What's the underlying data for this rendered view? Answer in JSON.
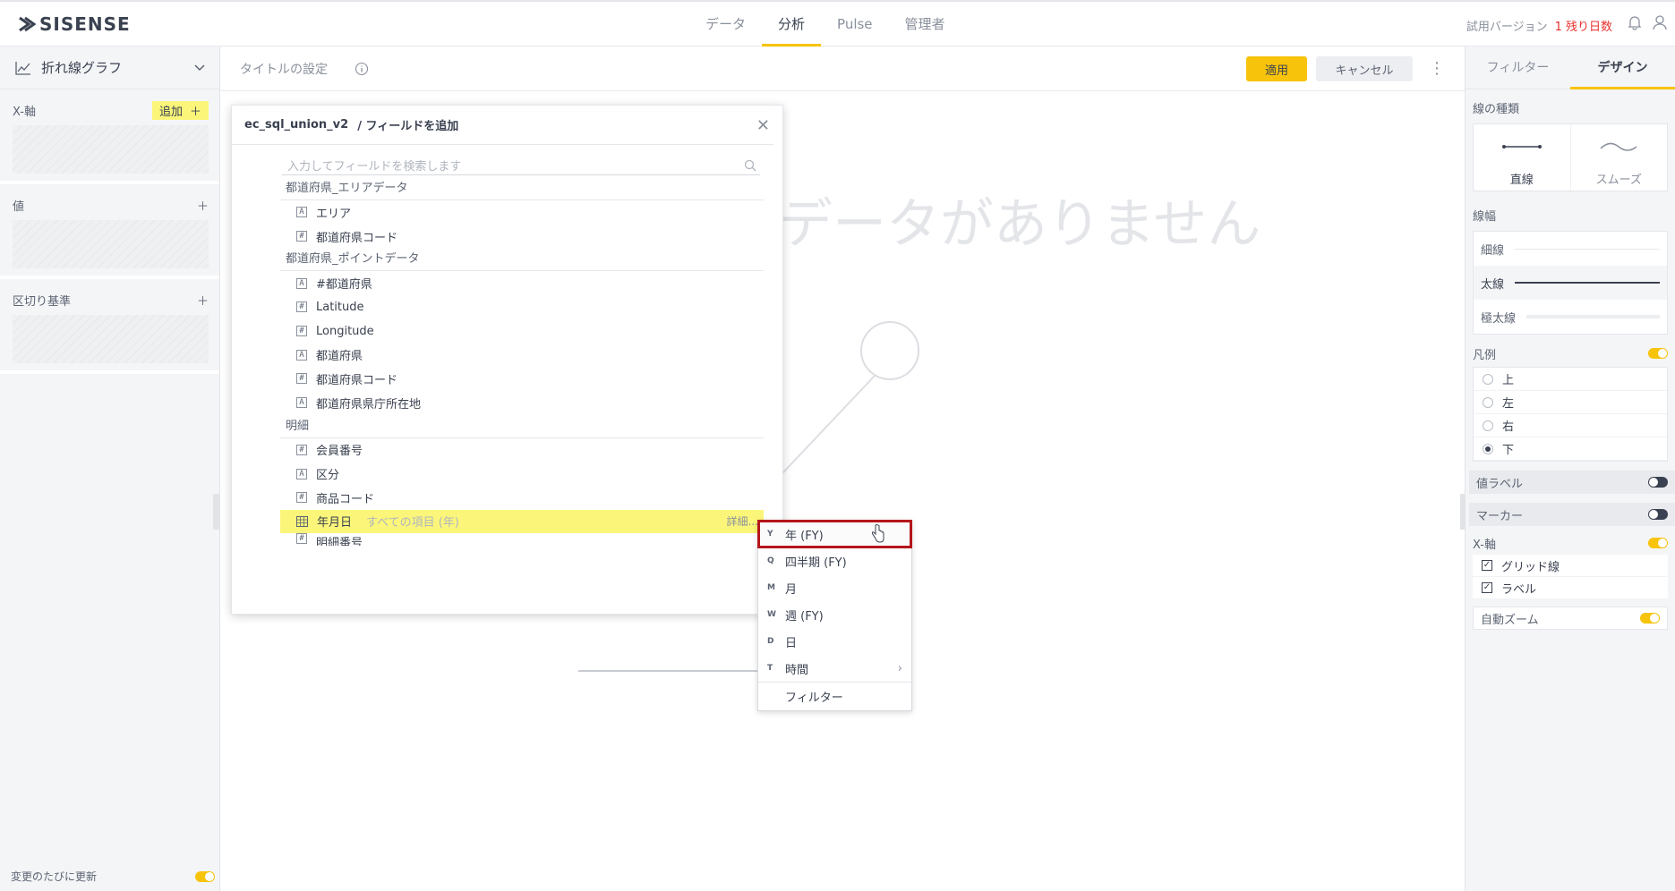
{
  "header": {
    "logo_text": "SISENSE",
    "tabs": [
      {
        "label": "データ"
      },
      {
        "label": "分析"
      },
      {
        "label": "Pulse"
      },
      {
        "label": "管理者"
      }
    ],
    "trial_label": "試用バージョン",
    "trial_days": "1 残り日数"
  },
  "left_panel": {
    "chart_type": "折れ線グラフ",
    "xaxis_label": "X-軸",
    "add_label": "追加",
    "values_label": "値",
    "breakby_label": "区切り基準",
    "auto_update_label": "変更のたびに更新"
  },
  "toolbar": {
    "title_placeholder": "タイトルの設定",
    "apply": "適用",
    "cancel": "キャンセル"
  },
  "canvas": {
    "no_data": "データがありません"
  },
  "dialog": {
    "source": "ec_sql_union_v2",
    "title": "/ フィールドを追加",
    "search_placeholder": "入力してフィールドを検索します",
    "groups": [
      {
        "name": "都道府県_エリアデータ",
        "fields": [
          {
            "type": "A",
            "name": "エリア"
          },
          {
            "type": "#",
            "name": "都道府県コード"
          }
        ]
      },
      {
        "name": "都道府県_ポイントデータ",
        "fields": [
          {
            "type": "A",
            "name": "#都道府県"
          },
          {
            "type": "#",
            "name": "Latitude"
          },
          {
            "type": "#",
            "name": "Longitude"
          },
          {
            "type": "A",
            "name": "都道府県"
          },
          {
            "type": "#",
            "name": "都道府県コード"
          },
          {
            "type": "A",
            "name": "都道府県県庁所在地"
          }
        ]
      },
      {
        "name": "明細",
        "fields": [
          {
            "type": "#",
            "name": "会員番号"
          },
          {
            "type": "A",
            "name": "区分"
          },
          {
            "type": "#",
            "name": "商品コード"
          }
        ]
      }
    ],
    "selected_field": {
      "name": "年月日",
      "hint": "すべての項目 (年)",
      "more": "詳細..."
    },
    "partial_field": "明細番号"
  },
  "context_menu": {
    "items": [
      {
        "key": "Y",
        "label": "年 (FY)"
      },
      {
        "key": "Q",
        "label": "四半期 (FY)"
      },
      {
        "key": "M",
        "label": "月"
      },
      {
        "key": "W",
        "label": "週 (FY)"
      },
      {
        "key": "D",
        "label": "日"
      },
      {
        "key": "T",
        "label": "時間"
      }
    ],
    "filter": "フィルター"
  },
  "right_panel": {
    "tabs": [
      {
        "label": "フィルター"
      },
      {
        "label": "デザイン"
      }
    ],
    "line_type_label": "線の種類",
    "line_types": [
      {
        "label": "直線"
      },
      {
        "label": "スムーズ"
      }
    ],
    "line_width_label": "線幅",
    "widths": [
      {
        "label": "細線"
      },
      {
        "label": "太線"
      },
      {
        "label": "極太線"
      }
    ],
    "legend_label": "凡例",
    "legend_positions": [
      {
        "label": "上"
      },
      {
        "label": "左"
      },
      {
        "label": "右"
      },
      {
        "label": "下"
      }
    ],
    "value_labels": "値ラベル",
    "markers": "マーカー",
    "xaxis": "X-軸",
    "grid": "グリッド線",
    "labels": "ラベル",
    "auto_zoom": "自動ズーム",
    "accent_color": "#f7c30b"
  }
}
